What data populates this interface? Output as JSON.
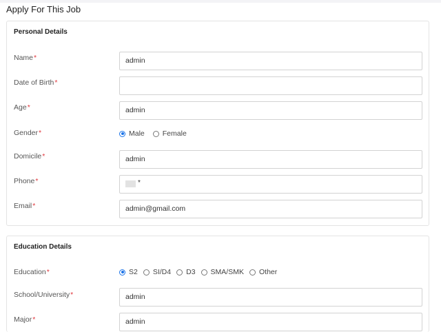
{
  "page": {
    "title": "Apply For This Job"
  },
  "personal": {
    "section_title": "Personal Details",
    "name": {
      "label": "Name",
      "req": "*",
      "value": "admin"
    },
    "dob": {
      "label": "Date of Birth",
      "req": "*",
      "value": ""
    },
    "age": {
      "label": "Age",
      "req": "*",
      "value": "admin"
    },
    "gender": {
      "label": "Gender",
      "req": "*",
      "options": [
        "Male",
        "Female"
      ],
      "selected": "Male"
    },
    "domicile": {
      "label": "Domicile",
      "req": "*",
      "value": "admin"
    },
    "phone": {
      "label": "Phone",
      "req": "*",
      "value": "*"
    },
    "email": {
      "label": "Email",
      "req": "*",
      "value": "admin@gmail.com"
    }
  },
  "education": {
    "section_title": "Education Details",
    "level": {
      "label": "Education",
      "req": "*",
      "options": [
        "S2",
        "SI/D4",
        "D3",
        "SMA/SMK",
        "Other"
      ],
      "selected": "S2"
    },
    "school": {
      "label": "School/University",
      "req": "*",
      "value": "admin"
    },
    "major": {
      "label": "Major",
      "req": "*",
      "value": "admin"
    }
  },
  "colors": {
    "accent": "#1a73e8",
    "required": "#e0383e",
    "border": "#d2d2d2"
  }
}
